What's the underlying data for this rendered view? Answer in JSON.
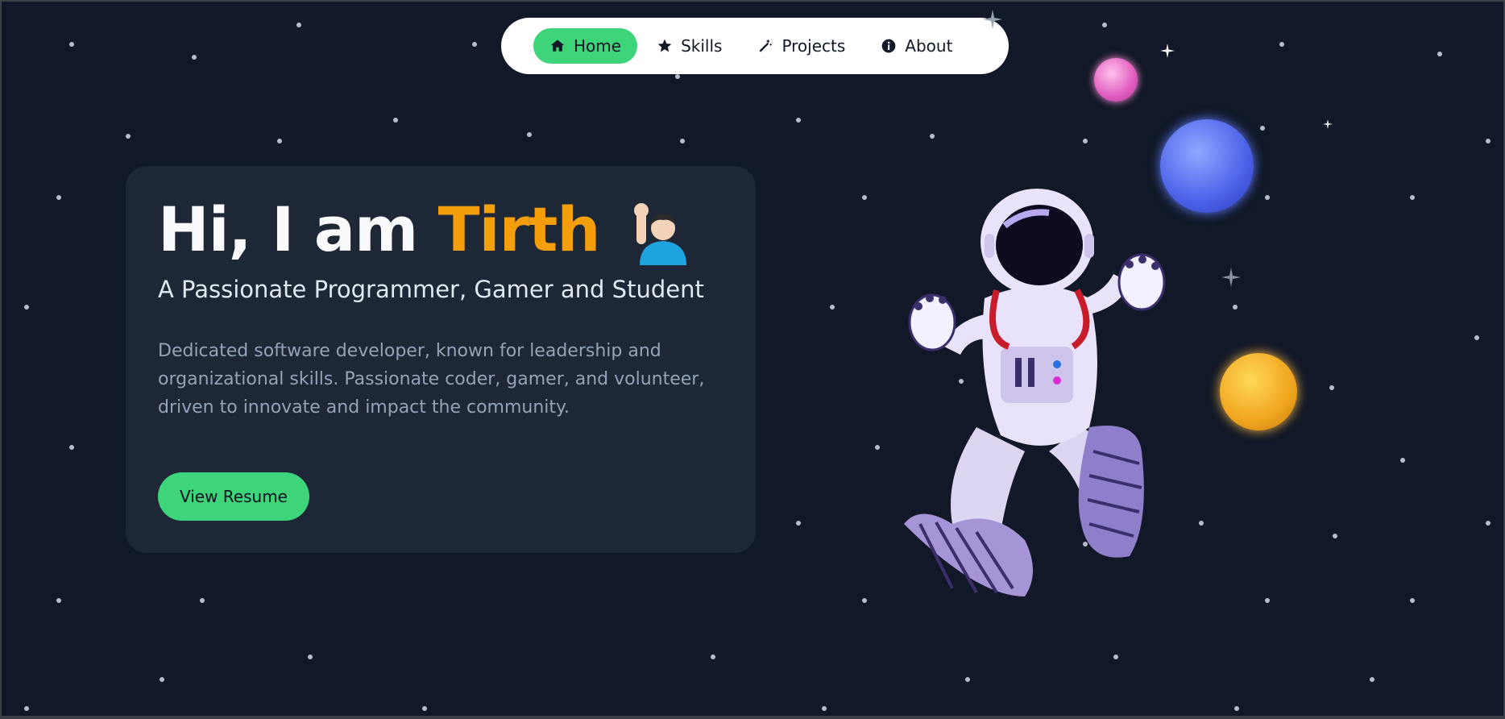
{
  "nav": {
    "items": [
      {
        "label": "Home",
        "icon": "home-icon",
        "active": true
      },
      {
        "label": "Skills",
        "icon": "star-icon",
        "active": false
      },
      {
        "label": "Projects",
        "icon": "magic-wand-icon",
        "active": false
      },
      {
        "label": "About",
        "icon": "info-icon",
        "active": false
      }
    ]
  },
  "hero": {
    "greeting": "Hi, I am",
    "name": "Tirth",
    "subtitle": "A Passionate Programmer, Gamer and Student",
    "description": "Dedicated software developer, known for leadership and organizational skills. Passionate coder, gamer, and volunteer, driven to innovate and impact the community.",
    "button_label": "View Resume"
  },
  "colors": {
    "background": "#111827",
    "card": "#1e2735",
    "accent_green": "#3ed47a",
    "accent_orange": "#f59e0b"
  },
  "illustration": {
    "figure": "astronaut-illustration",
    "planets": [
      "pink-planet",
      "blue-planet",
      "yellow-planet"
    ]
  }
}
